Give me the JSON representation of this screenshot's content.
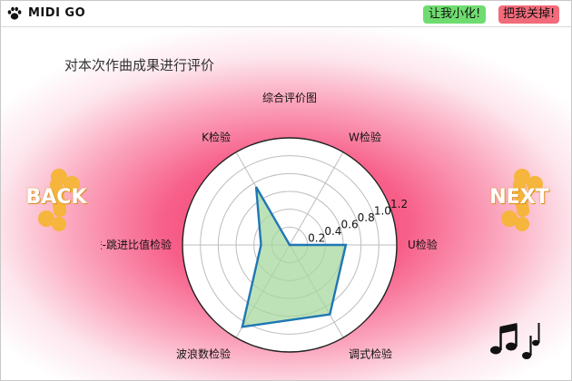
{
  "window": {
    "app_title": "MIDI GO",
    "minimize_label": "让我小化!",
    "close_label": "把我关掉!"
  },
  "page": {
    "title": "对本次作曲成果进行评价"
  },
  "nav": {
    "back_label": "BACK",
    "next_label": "NEXT"
  },
  "icons": {
    "app": "paw-icon",
    "music": "music-notes-icon"
  },
  "colors": {
    "minimize_button": "#6fdc6f",
    "close_button": "#f26b7a",
    "background_center": "#f2386a",
    "series_line": "#1f77b4",
    "series_fill": "#a8d8a0"
  },
  "chart_data": {
    "type": "radar",
    "title": "综合评价图",
    "axes": [
      "U检验",
      "W检验",
      "K检验",
      "级进-跳进比值检验",
      "波浪数检验",
      "调式检验"
    ],
    "series": [
      {
        "values": [
          0.63,
          0.0,
          0.75,
          0.32,
          1.06,
          0.9
        ]
      }
    ],
    "radial_ticks": [
      "0.2",
      "0.4",
      "0.6",
      "0.8",
      "1.0",
      "1.2"
    ],
    "rlim": [
      0,
      1.2
    ],
    "grid": true
  }
}
